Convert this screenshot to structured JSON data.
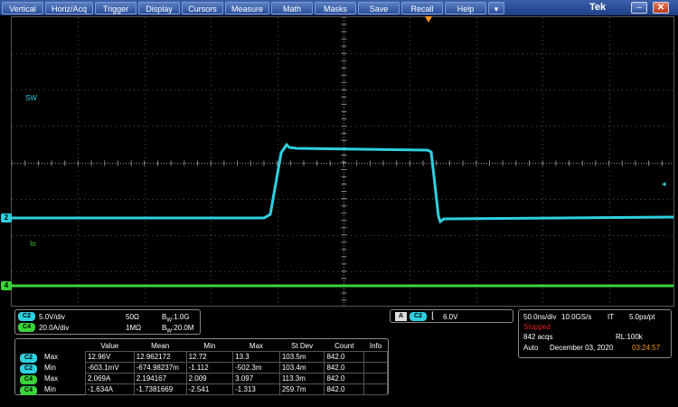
{
  "menu": {
    "items": [
      "Vertical",
      "Horiz/Acq",
      "Trigger",
      "Display",
      "Cursors",
      "Measure",
      "Math",
      "Masks",
      "Save",
      "Recall",
      "Help"
    ],
    "dropdown_icon": "chevron-down-icon",
    "brand": "Tek",
    "minimize_icon": "minimize-icon",
    "close_icon": "close-icon"
  },
  "traces": {
    "ch2_marker": "2",
    "ch4_marker": "4",
    "ch2_label": "SW",
    "ch4_label": "Io",
    "colors": {
      "ch2": "#2fd0e0",
      "ch4": "#3ad43a",
      "trigger": "#f39a1a",
      "stopped": "#e82020"
    }
  },
  "channels": [
    {
      "badge": "C2",
      "scale": "5.0V/div",
      "impedance": "50Ω",
      "bandwidth_prefix": "B",
      "bandwidth_sub": "W",
      "bandwidth": ":1.0G"
    },
    {
      "badge": "C4",
      "scale": "20.0A/div",
      "impedance": "1MΩ",
      "bandwidth_prefix": "B",
      "bandwidth_sub": "W",
      "bandwidth": ":20.0M"
    }
  ],
  "trigger": {
    "label": "A",
    "source": "C2",
    "slope_icon": "falling-edge-icon",
    "level": "6.0V"
  },
  "acquisition": {
    "timebase": "50.0ns/div",
    "sample_rate": "10.0GS/s",
    "mode": "IT",
    "pts_per_div": "5.0ps/pt",
    "status": "Stopped",
    "count": "842 acqs",
    "record_length": "RL:100k",
    "trigger_mode": "Auto",
    "date": "December 03, 2020",
    "time": "03:24:57"
  },
  "measurements": {
    "headers": [
      "",
      "",
      "Value",
      "Mean",
      "Min",
      "Max",
      "St Dev",
      "Count",
      "Info"
    ],
    "rows": [
      {
        "source": "C2",
        "stat": "Max",
        "value": "12.96V",
        "mean": "12.962172",
        "min": "12.72",
        "max": "13.3",
        "stdev": "103.5m",
        "count": "842.0",
        "info": ""
      },
      {
        "source": "C2",
        "stat": "Min",
        "value": "-603.1mV",
        "mean": "-674.98237m",
        "min": "-1.112",
        "max": "-502.3m",
        "stdev": "103.4m",
        "count": "842.0",
        "info": ""
      },
      {
        "source": "C4",
        "stat": "Max",
        "value": "2.069A",
        "mean": "2.194167",
        "min": "2.009",
        "max": "3.097",
        "stdev": "113.3m",
        "count": "842.0",
        "info": ""
      },
      {
        "source": "C4",
        "stat": "Min",
        "value": "-1.634A",
        "mean": "-1.7381669",
        "min": "-2.541",
        "max": "-1.313",
        "stdev": "259.7m",
        "count": "842.0",
        "info": ""
      }
    ]
  }
}
